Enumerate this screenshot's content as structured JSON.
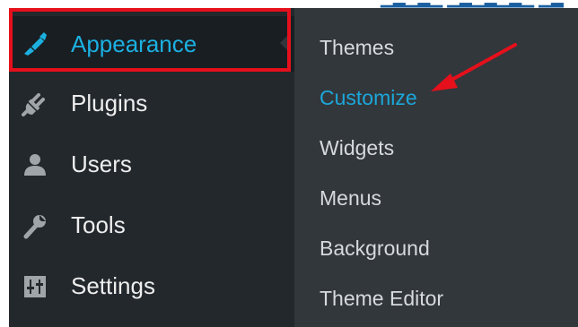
{
  "admin_menu": {
    "items": [
      {
        "label": "Appearance",
        "icon": "paint-brush-icon",
        "active": true
      },
      {
        "label": "Plugins",
        "icon": "plug-icon"
      },
      {
        "label": "Users",
        "icon": "user-icon"
      },
      {
        "label": "Tools",
        "icon": "wrench-icon"
      },
      {
        "label": "Settings",
        "icon": "sliders-icon"
      }
    ]
  },
  "submenu": {
    "items": [
      {
        "label": "Themes"
      },
      {
        "label": "Customize",
        "current": true
      },
      {
        "label": "Widgets"
      },
      {
        "label": "Menus"
      },
      {
        "label": "Background"
      },
      {
        "label": "Theme Editor"
      }
    ]
  },
  "colors": {
    "menu_bg": "#23282d",
    "submenu_bg": "#32373c",
    "accent": "#1cb0e1",
    "annotation_red": "#e5101b"
  },
  "annotation": {
    "highlight": "red-box-around-appearance",
    "arrow_target": "Customize"
  }
}
